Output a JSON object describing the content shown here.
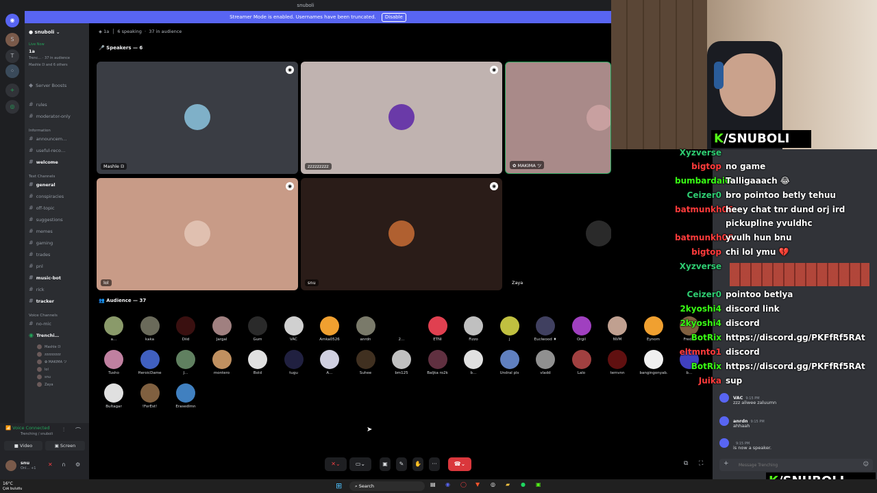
{
  "window": {
    "title": "snuboli"
  },
  "banner": {
    "text": "Streamer Mode is enabled. Usernames have been truncated.",
    "button": "Disable"
  },
  "guild": {
    "name": "snuboli",
    "live_label": "Live Now",
    "live_channel": "1a",
    "live_stage": "Trenc…",
    "live_audience": "37 in audience",
    "live_speakers": "Mashle 𝔻 and 6 others",
    "boosts": "Server Boosts"
  },
  "channels": [
    {
      "name": "rules",
      "type": "text",
      "bold": false
    },
    {
      "name": "moderator-only",
      "type": "text",
      "bold": false
    },
    {
      "name": "Information",
      "type": "category"
    },
    {
      "name": "announcem…",
      "type": "text",
      "bold": false
    },
    {
      "name": "useful-reco…",
      "type": "text",
      "bold": false
    },
    {
      "name": "welcome",
      "type": "text",
      "bold": true
    },
    {
      "name": "Text Channels",
      "type": "category"
    },
    {
      "name": "general",
      "type": "text",
      "bold": true
    },
    {
      "name": "conspiracies",
      "type": "text",
      "bold": false
    },
    {
      "name": "off-topic",
      "type": "text",
      "bold": false
    },
    {
      "name": "suggestions",
      "type": "text",
      "bold": false
    },
    {
      "name": "memes",
      "type": "text",
      "bold": false
    },
    {
      "name": "gaming",
      "type": "text",
      "bold": false
    },
    {
      "name": "trades",
      "type": "text",
      "bold": false
    },
    {
      "name": "pnl",
      "type": "text",
      "bold": false
    },
    {
      "name": "music-bot",
      "type": "text",
      "bold": true
    },
    {
      "name": "rick",
      "type": "text",
      "bold": false
    },
    {
      "name": "tracker",
      "type": "text",
      "bold": true
    },
    {
      "name": "Voice Channels",
      "type": "category"
    },
    {
      "name": "no-mic",
      "type": "text",
      "bold": false
    },
    {
      "name": "Trenchi…",
      "type": "stage",
      "bold": true
    }
  ],
  "stage_members": [
    "Mashle 𝔻",
    "zzzzzzzzz",
    "✿ MAKIMA ツ",
    "lol",
    "snu",
    "Zaya"
  ],
  "voice": {
    "status": "Voice Connected",
    "subtitle": "Trenching / snuboli",
    "video": "Video",
    "screen": "Screen"
  },
  "user": {
    "name": "snu",
    "status": "Onl… +1"
  },
  "stage": {
    "channel": "1a",
    "speaking": "6 speaking",
    "audience": "37 in audience",
    "speakers_label": "Speakers — 6",
    "audience_label": "Audience — 37"
  },
  "speakers": [
    {
      "name": "Mashle 𝔻",
      "bg": "#3a3d44"
    },
    {
      "name": "zzzzzzzzz",
      "bg": "#c0b3b0"
    },
    {
      "name": "✿ MAKIMA ツ",
      "bg": "#a98a89"
    },
    {
      "name": "lol",
      "bg": "#c89b87"
    },
    {
      "name": "snu",
      "bg": "#2a1c18"
    },
    {
      "name": "Zaya",
      "bg": "#000000"
    }
  ],
  "audience": [
    "a…",
    "kaka",
    "Diid",
    "Jargal",
    "Gum",
    "VAC",
    "Amka0526",
    "anrdn",
    "2…",
    "ETNI",
    "Fizzo",
    "j",
    "Euclwood ♦",
    "Orgil",
    "NVM",
    "Eynom",
    "Freddi",
    "Tusho",
    "HeroicDame",
    "J…",
    "montero",
    "Bold",
    "tugu",
    "A…",
    "Suhee",
    "bm125",
    "Baljka ro2k",
    "b…",
    "Undral pls",
    "vladd",
    "Lalo",
    "temvnn",
    "bangingonyab…",
    "b…",
    "Bultagar",
    "!ForEst!",
    "Erasedlmn"
  ],
  "audience_colors": [
    "#8a9a6a",
    "#6a6a5a",
    "#3a1010",
    "#a08080",
    "#2a2a2a",
    "#d0d0d0",
    "#f0a030",
    "#7a7a6a",
    "#000000",
    "#e04050",
    "#c0c0c0",
    "#c0c040",
    "#404060",
    "#a040c0",
    "#c0a090",
    "#f0a030",
    "#806040",
    "#c080a0",
    "#4060c0",
    "#608060",
    "#c09060",
    "#e0e0e0",
    "#202040",
    "#d0d0e0",
    "#403020",
    "#c0c0c0",
    "#603040",
    "#e0e0e0",
    "#6080c0",
    "#909090",
    "#a04040",
    "#601010",
    "#f0f0f0",
    "#4040c0",
    "#e0e0e0",
    "#806040",
    "#4080c0"
  ],
  "overlay_chat": [
    {
      "user": "Xyzverse",
      "color": "#2ecc71",
      "msg": ""
    },
    {
      "user": "bigtop",
      "color": "#ff3b3b",
      "msg": "no game"
    },
    {
      "user": "bumbardai0",
      "color": "#39ff14",
      "msg": "Talligaaach 😂"
    },
    {
      "user": "Ceizer0",
      "color": "#2ecc71",
      "msg": "bro pointoo betly tehuu"
    },
    {
      "user": "batmunkh06",
      "color": "#ff3b3b",
      "msg": "heey chat tnr dund orj ird"
    },
    {
      "user": "",
      "color": "#ffffff",
      "msg": "pickupline yvuldhc"
    },
    {
      "user": "batmunkh06",
      "color": "#ff3b3b",
      "msg": "yvulh hun bnu"
    },
    {
      "user": "bigtop",
      "color": "#ff3b3b",
      "msg": "chi lol ymu 💔"
    },
    {
      "user": "Xyzverse",
      "color": "#2ecc71",
      "msg": ""
    },
    {
      "user": "Ceizer0",
      "color": "#2ecc71",
      "msg": "pointoo betlya"
    },
    {
      "user": "2kyoshi4",
      "color": "#39ff14",
      "msg": "discord link"
    },
    {
      "user": "2kyoshi4",
      "color": "#39ff14",
      "msg": "discord"
    },
    {
      "user": "BotRix",
      "color": "#39ff14",
      "msg": "https://discord.gg/PKFfRf5RAt"
    },
    {
      "user": "eltmnto1",
      "color": "#ff3b3b",
      "msg": "discord"
    },
    {
      "user": "BotRix",
      "color": "#39ff14",
      "msg": "https://discord.gg/PKFfRf5RAt"
    },
    {
      "user": "Juika",
      "color": "#ff3b3b",
      "msg": "sup"
    }
  ],
  "discord_chat": [
    {
      "user": "VAC",
      "msg": "zzz aliwee zaluumn",
      "time": "9:15 PM"
    },
    {
      "user": "anrdn",
      "msg": "ahhaah",
      "time": "9:15 PM"
    },
    {
      "user": "",
      "msg": "is now a speaker.",
      "time": "9:15 PM"
    }
  ],
  "chat_input": {
    "placeholder": "Message Trenching"
  },
  "stream_brand": {
    "text": "/SNUBOLI",
    "k": "K"
  },
  "taskbar": {
    "search": "Search",
    "weather_temp": "16°C",
    "weather_desc": "Çok bulutlu"
  }
}
